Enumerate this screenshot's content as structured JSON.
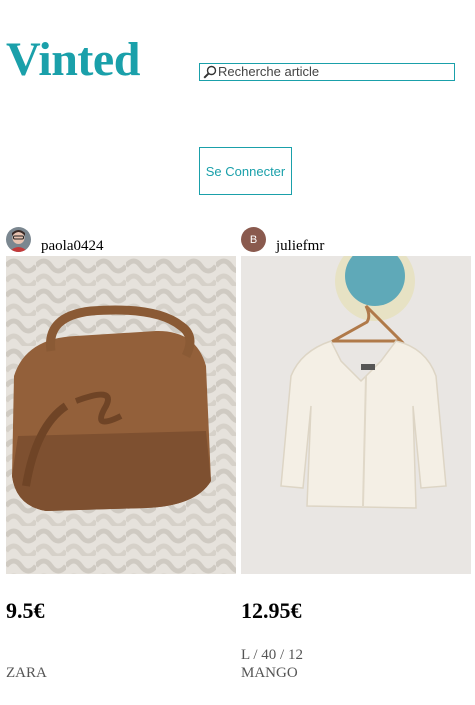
{
  "header": {
    "logo": "Vinted",
    "search_placeholder": "Recherche article"
  },
  "login_button": "Se Connecter",
  "items": [
    {
      "seller": "paola0424",
      "price": "9.5€",
      "size": "",
      "brand": "ZARA"
    },
    {
      "seller": "juliefmr",
      "seller_initial": "B",
      "price": "12.95€",
      "size": "L / 40 / 12",
      "brand": "MANGO"
    }
  ],
  "colors": {
    "brand": "#1aa0aa",
    "avatar_letter_bg": "#8a5a4e"
  }
}
